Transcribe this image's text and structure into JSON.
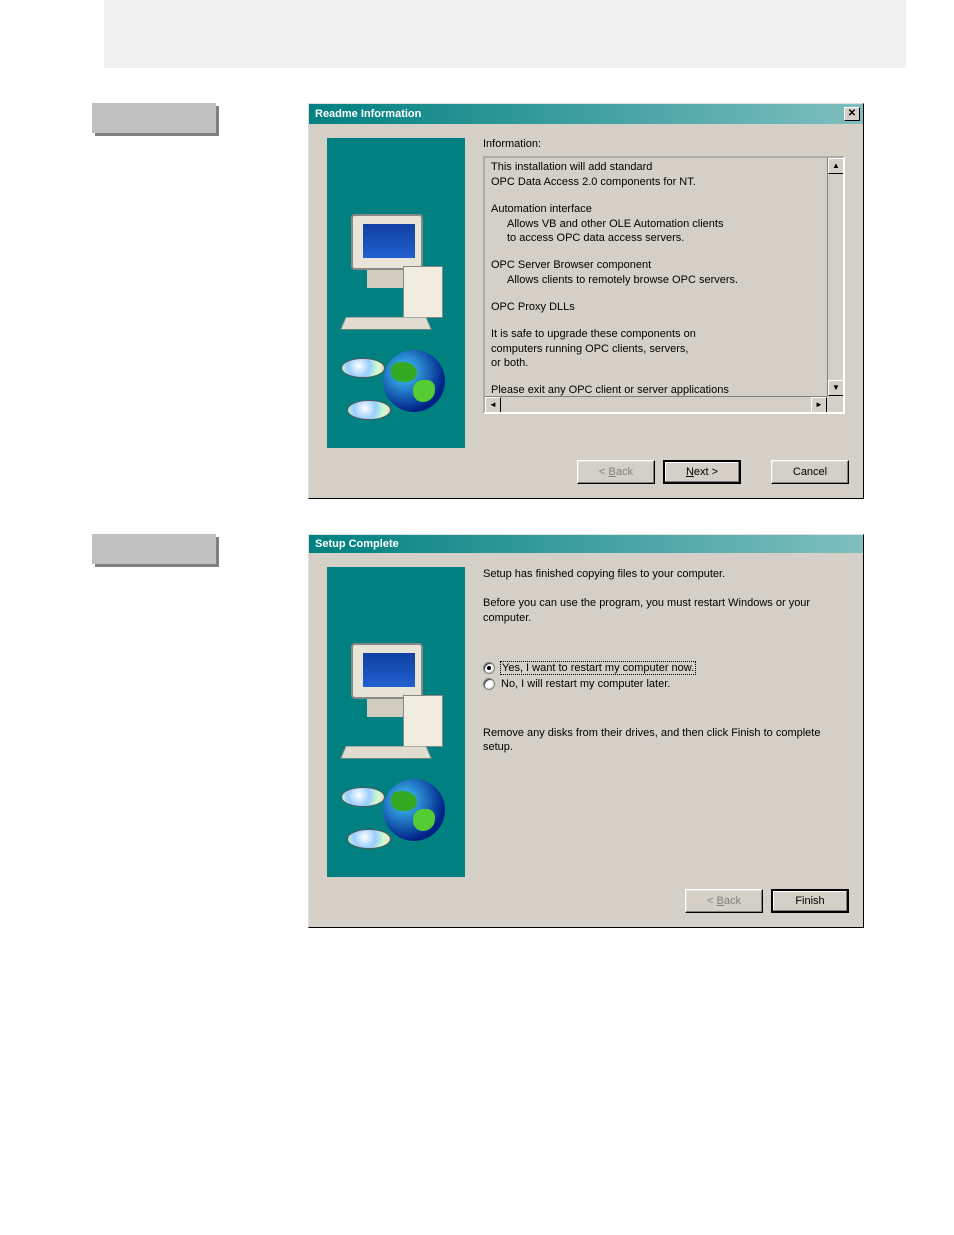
{
  "dialog1": {
    "title": "Readme Information",
    "info_label": "Information:",
    "lines": {
      "l1": "This installation will add standard",
      "l2": "OPC Data Access 2.0 components for NT.",
      "l3": "Automation interface",
      "l4": "Allows VB and other OLE Automation clients",
      "l5": "to access OPC data access servers.",
      "l6": "OPC Server Browser component",
      "l7": "Allows clients to remotely browse OPC servers.",
      "l8": "OPC Proxy DLLs",
      "l9": "It is safe to upgrade these components on",
      "l10": "computers running OPC clients, servers,",
      "l11": "or both.",
      "l12": "Please exit any OPC client or server applications"
    },
    "buttons": {
      "back_lt": "< ",
      "back_label": "B",
      "back_rest": "ack",
      "next_label": "N",
      "next_rest": "ext >",
      "cancel": "Cancel"
    }
  },
  "dialog2": {
    "title": "Setup Complete",
    "p1": "Setup has finished copying files to your computer.",
    "p2": "Before you can use the program, you must restart Windows or your computer.",
    "radio_yes": "Yes, I want to restart my computer now.",
    "radio_no": "No, I will restart my computer later.",
    "p3": "Remove any disks from their drives, and then click Finish to complete setup.",
    "buttons": {
      "back_lt": "< ",
      "back_label": "B",
      "back_rest": "ack",
      "finish": "Finish"
    }
  }
}
